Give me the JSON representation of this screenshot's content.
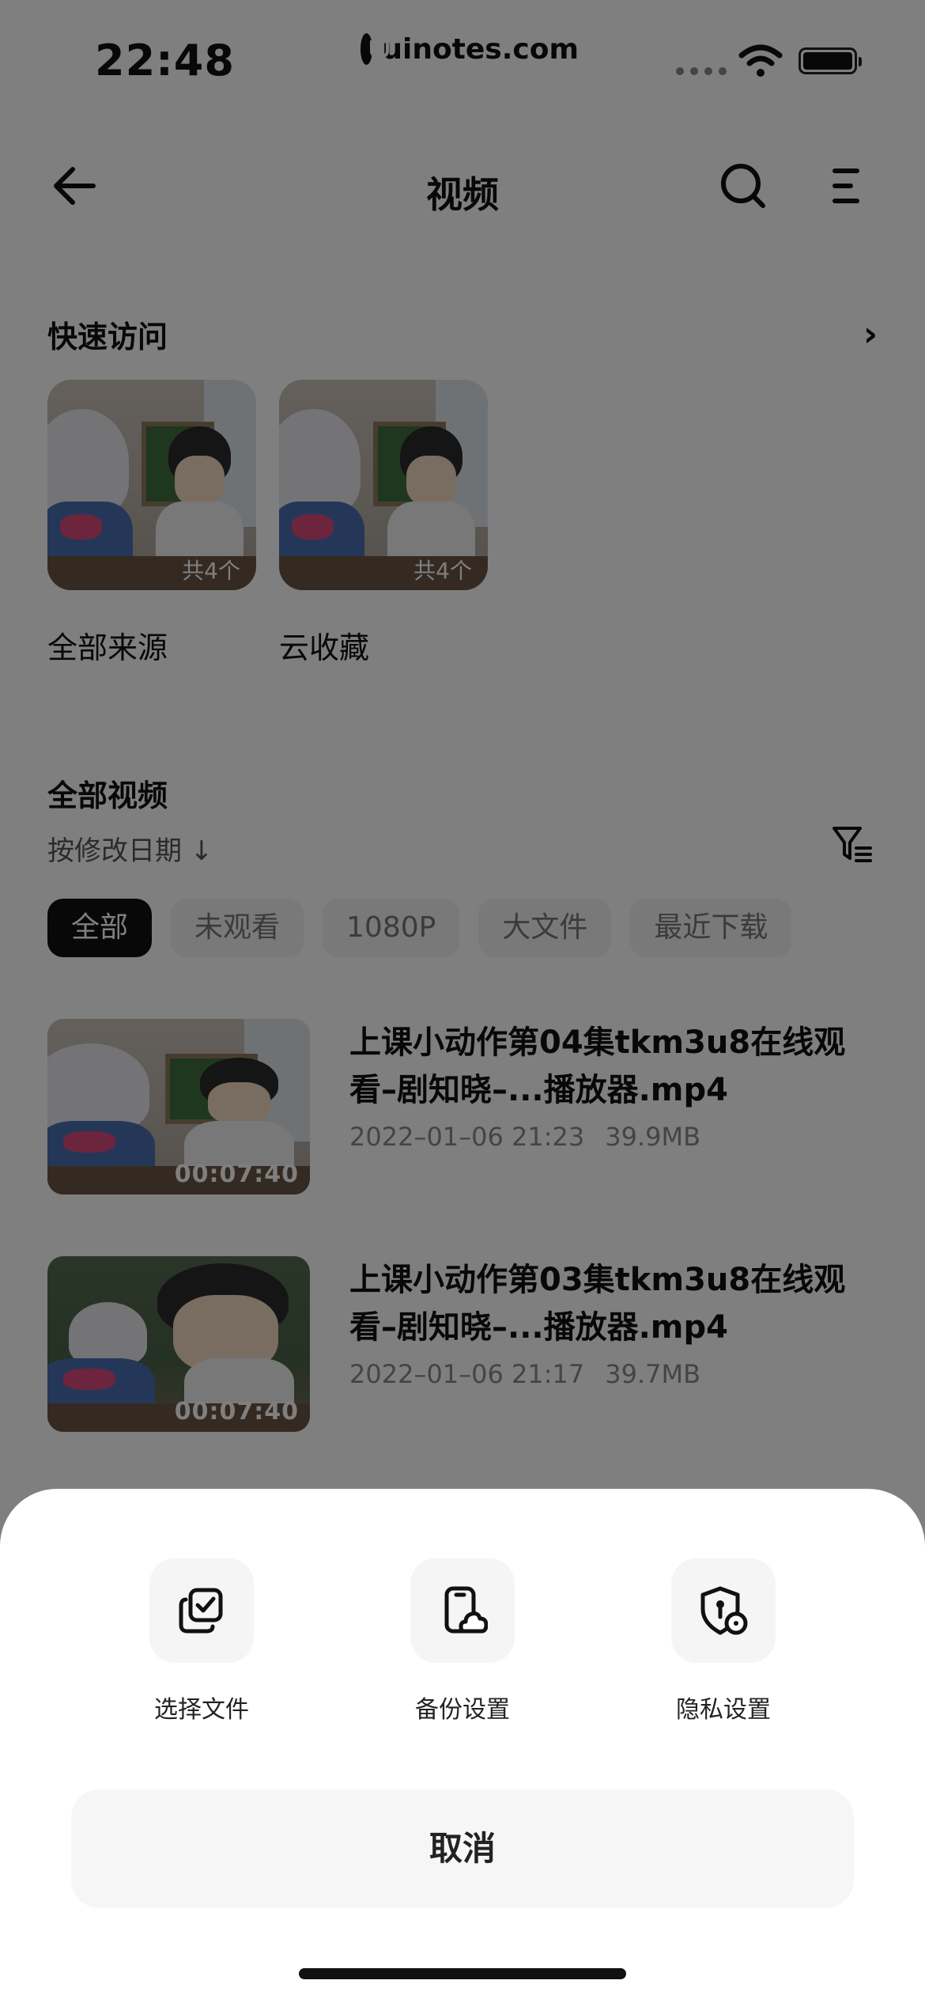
{
  "status_bar": {
    "time": "22:48",
    "watermark": "uinotes.com"
  },
  "nav": {
    "title": "视频",
    "back_icon": "arrow-left-icon",
    "search_icon": "search-icon",
    "menu_icon": "menu-icon"
  },
  "quick_access": {
    "title": "快速访问",
    "items": [
      {
        "label": "全部来源",
        "count": "共4个"
      },
      {
        "label": "云收藏",
        "count": "共4个"
      }
    ]
  },
  "videos_panel": {
    "title": "全部视频",
    "sort_label": "按修改日期 ↓",
    "chips": [
      "全部",
      "未观看",
      "1080P",
      "大文件",
      "最近下载"
    ],
    "videos": [
      {
        "title": "上课小动作第04集tkm3u8在线观看–剧知晓–...播放器.mp4",
        "date": "2022–01–06 21:23",
        "size": "39.9MB",
        "duration": "00:07:40"
      },
      {
        "title": "上课小动作第03集tkm3u8在线观看–剧知晓–...播放器.mp4",
        "date": "2022–01–06 21:17",
        "size": "39.7MB",
        "duration": "00:07:40"
      }
    ]
  },
  "sheet": {
    "actions": [
      {
        "label": "选择文件",
        "icon": "select-files-icon"
      },
      {
        "label": "备份设置",
        "icon": "backup-settings-icon"
      },
      {
        "label": "隐私设置",
        "icon": "privacy-settings-icon"
      }
    ],
    "cancel_label": "取消"
  }
}
